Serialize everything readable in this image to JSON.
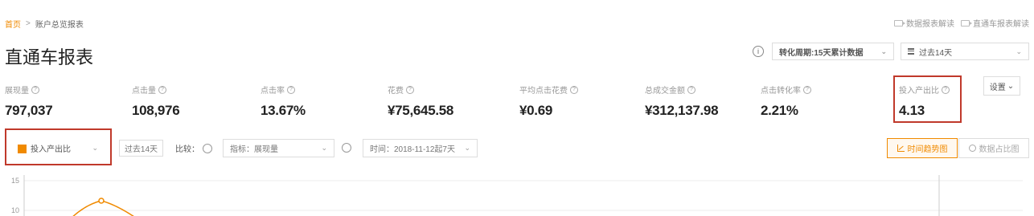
{
  "breadcrumb": {
    "home": "首页",
    "separator": ">",
    "current": "账户总览报表"
  },
  "top_links": [
    {
      "label": "数据报表解读",
      "icon": "video-icon"
    },
    {
      "label": "直通车报表解读",
      "icon": "video-icon"
    }
  ],
  "page_title": "直通车报表",
  "controls": {
    "info_glyph": "i",
    "conversion_period": "转化周期:15天累计数据",
    "date_range": "过去14天"
  },
  "metrics": [
    {
      "label": "展现量",
      "value": "797,037"
    },
    {
      "label": "点击量",
      "value": "108,976"
    },
    {
      "label": "点击率",
      "value": "13.67%"
    },
    {
      "label": "花费",
      "value": "¥75,645.58"
    },
    {
      "label": "平均点击花费",
      "value": "¥0.69"
    },
    {
      "label": "总成交金额",
      "value": "¥312,137.98"
    },
    {
      "label": "点击转化率",
      "value": "2.21%"
    },
    {
      "label": "投入产出比",
      "value": "4.13"
    }
  ],
  "help_glyph": "?",
  "settings_label": "设置",
  "filters": {
    "primary_metric": "投入产出比",
    "range_button": "过去14天",
    "compare_label": "比较：",
    "indicator_select": "指标：展现量",
    "time_select": "时间：2018-11-12起7天"
  },
  "view_buttons": {
    "trend": "时间趋势图",
    "ratio": "数据占比图"
  },
  "colors": {
    "accent": "#f08a00",
    "highlight": "#c0392b"
  },
  "chart_data": {
    "type": "line",
    "y_ticks": [
      "15",
      "10"
    ],
    "visible_points": [
      {
        "x": 1,
        "y": 12
      }
    ]
  }
}
